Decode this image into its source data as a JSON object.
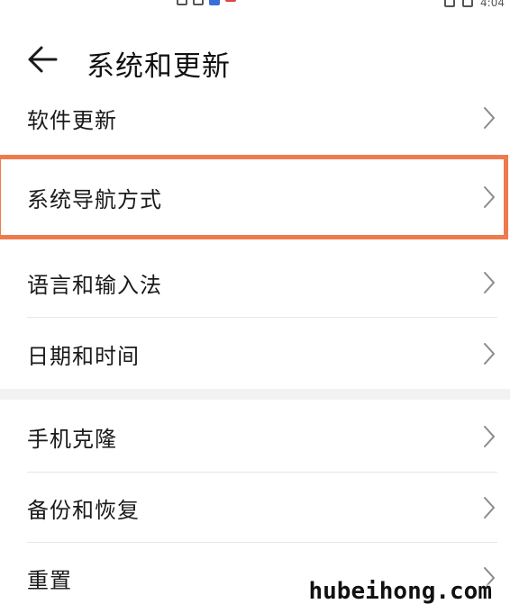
{
  "status_bar": {
    "time": "4:04"
  },
  "header": {
    "title": "系统和更新",
    "back_icon": "arrow-left-icon"
  },
  "menu": {
    "items": [
      {
        "label": "软件更新"
      },
      {
        "label": "系统导航方式",
        "highlighted": true
      },
      {
        "label": "语言和输入法"
      },
      {
        "label": "日期和时间"
      },
      {
        "label": "手机克隆"
      },
      {
        "label": "备份和恢复"
      },
      {
        "label": "重置"
      }
    ],
    "chevron_icon": "chevron-right-icon"
  },
  "colors": {
    "highlight": "#ee7a4e",
    "background": "#ffffff",
    "section_gap": "#f2f2f2"
  },
  "watermark": "hubeihong.com"
}
